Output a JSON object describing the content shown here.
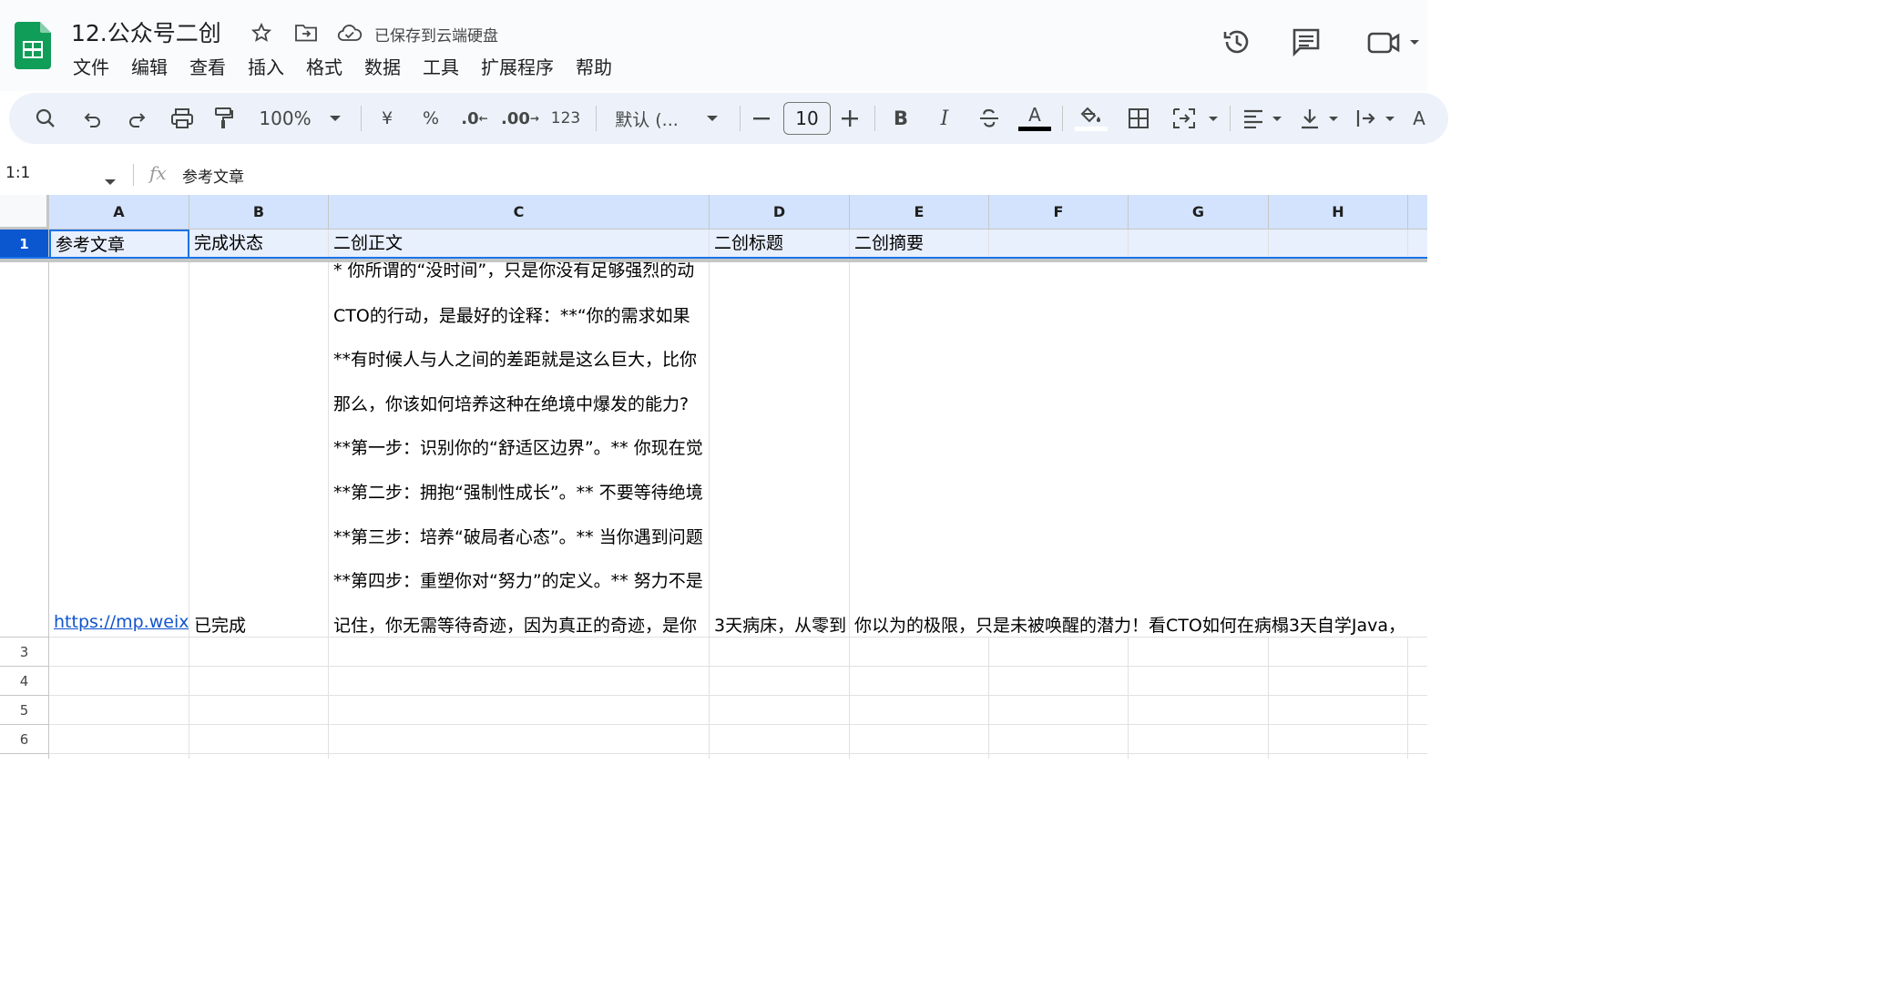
{
  "doc": {
    "title": "12.公众号二创",
    "save_status": "已保存到云端硬盘"
  },
  "menu": [
    "文件",
    "编辑",
    "查看",
    "插入",
    "格式",
    "数据",
    "工具",
    "扩展程序",
    "帮助"
  ],
  "toolbar": {
    "zoom": "100%",
    "currency": "¥",
    "percent": "%",
    "dec_decrease": ".0",
    "dec_increase": ".00",
    "number_format": "123",
    "font": "默认 (...",
    "font_size": "10"
  },
  "formula_bar": {
    "name_box": "1:1",
    "content": "参考文章"
  },
  "columns": [
    "A",
    "B",
    "C",
    "D",
    "E",
    "F",
    "G",
    "H"
  ],
  "rows": {
    "r1": {
      "label": "1",
      "A": "参考文章",
      "B": "完成状态",
      "C": "二创正文",
      "D": "二创标题",
      "E": "二创摘要"
    },
    "r2": {
      "A": "https://mp.weixin",
      "B": "已完成",
      "C_lines": [
        "* 你所谓的“没时间”，只是你没有足够强烈的动",
        "CTO的行动，是最好的诠释：**“你的需求如果",
        "**有时候人与人之间的差距就是这么巨大，比你",
        "那么，你该如何培养这种在绝境中爆发的能力?",
        "**第一步：识别你的“舒适区边界”。** 你现在觉",
        "**第二步：拥抱“强制性成长”。** 不要等待绝境",
        "**第三步：培养“破局者心态”。** 当你遇到问题",
        "**第四步：重塑你对“努力”的定义。** 努力不是",
        "记住，你无需等待奇迹，因为真正的奇迹，是你"
      ],
      "D": "3天病床，从零到",
      "E": "你以为的极限，只是未被唤醒的潜力！看CTO如何在病榻3天自学Java，"
    },
    "row_labels": [
      "3",
      "4",
      "5",
      "6"
    ]
  }
}
